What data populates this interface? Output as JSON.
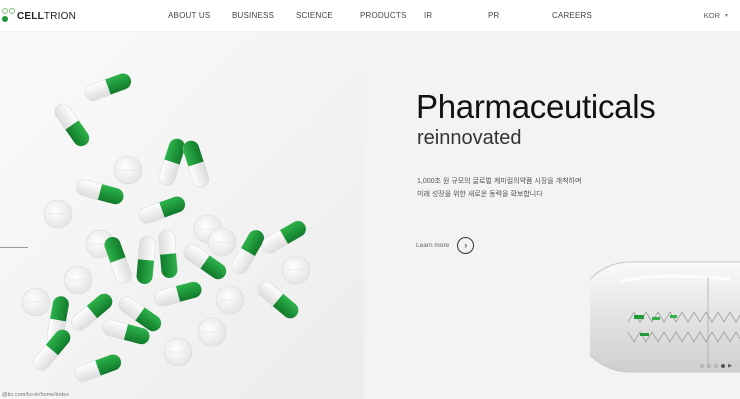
{
  "brand": {
    "name_bold": "CELL",
    "name_regular": "TRION",
    "colors": {
      "green": "#1f9a3a",
      "light_green": "#7cc576",
      "gray": "#bdbdbd"
    }
  },
  "nav": {
    "items": [
      {
        "label": "ABOUT US"
      },
      {
        "label": "BUSINESS"
      },
      {
        "label": "SCIENCE"
      },
      {
        "label": "PRODUCTS"
      },
      {
        "label": "IR"
      },
      {
        "label": "PR"
      },
      {
        "label": "CAREERS"
      }
    ],
    "language": "KOR"
  },
  "hero": {
    "title": "Pharmaceuticals",
    "subtitle": "reinnovated",
    "desc_line1": "1,000조 원 규모의 글로벌 케미컬의약품 시장을 개척하며",
    "desc_line2": "미래 성장을 위한 새로운 동력을 확보합니다",
    "learn_more": "Learn more",
    "learn_more_icon": "chevron-right-icon",
    "slides": {
      "count": 4,
      "active": 4
    }
  },
  "status_url": "@tin.com/ko-kr/home/index"
}
